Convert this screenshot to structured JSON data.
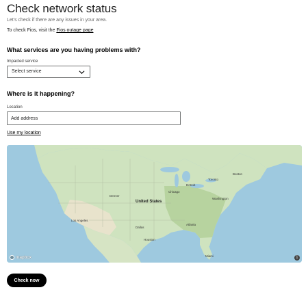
{
  "header": {
    "title": "Check network status",
    "subtitle": "Let's check if there are any issues in your area.",
    "fios_prefix": "To check Fios, visit the ",
    "fios_link": "Fios outage page"
  },
  "services": {
    "heading": "What services are you having problems with?",
    "label": "Impacted service",
    "selected": "Select service"
  },
  "location": {
    "heading": "Where is it happening?",
    "label": "Location",
    "placeholder": "Add address",
    "use_location": "Use my location"
  },
  "map": {
    "attribution": "mapbox",
    "info": "i",
    "country_label": "United States",
    "cities": [
      "Chicago",
      "Detroit",
      "Toronto",
      "Los Angeles",
      "Dallas",
      "Houston",
      "Denver",
      "Atlanta",
      "Miami",
      "Boston",
      "Washington"
    ],
    "colors": {
      "water": "#9ec9df",
      "land": "#cfe3bf",
      "land_dark": "#b7d39f",
      "desert": "#e8e3cc"
    }
  },
  "actions": {
    "check_now": "Check now"
  }
}
